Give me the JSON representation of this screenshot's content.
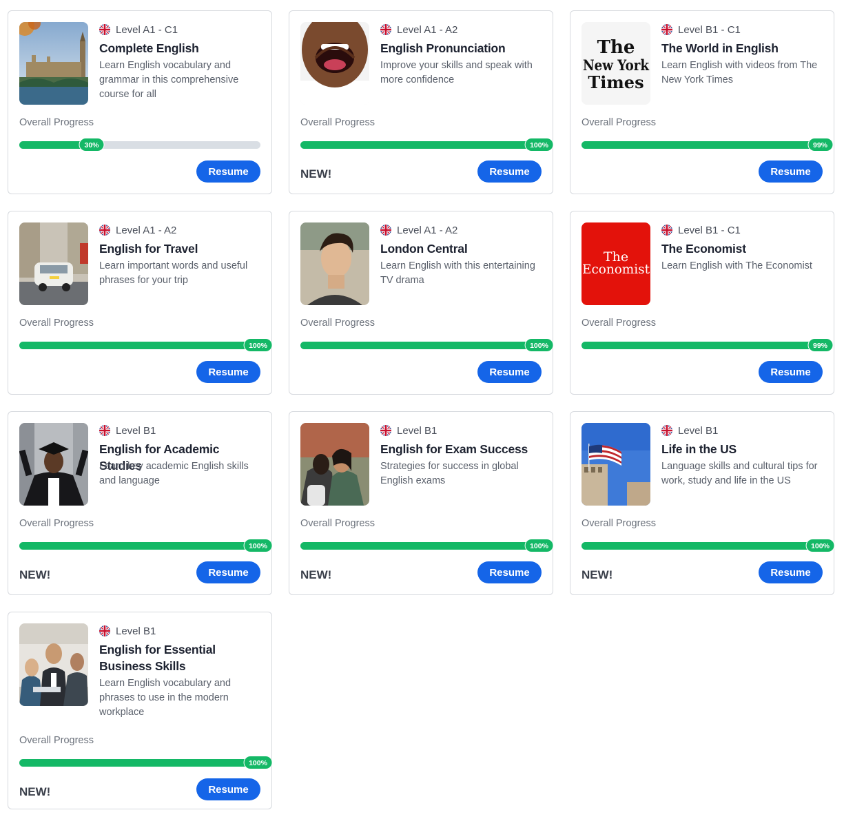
{
  "progress_label": "Overall Progress",
  "resume_label": "Resume",
  "new_label": "NEW!",
  "accent_color": "#14b866",
  "button_color": "#1565e8",
  "courses": [
    {
      "level": "Level A1 - C1",
      "title": "Complete English",
      "description": "Learn English vocabulary and grammar in this comprehensive course for all",
      "progress": 30,
      "progress_text": "30%",
      "is_new": false,
      "thumb": "london-bridge-image"
    },
    {
      "level": "Level A1 - A2",
      "title": "English Pronunciation",
      "description": "Improve your skills and speak with more confidence",
      "progress": 100,
      "progress_text": "100%",
      "is_new": true,
      "thumb": "open-mouth-image"
    },
    {
      "level": "Level B1 - C1",
      "title": "The World in English",
      "description": "Learn English with videos from The New York Times",
      "progress": 99,
      "progress_text": "99%",
      "is_new": false,
      "thumb": "nyt-logo",
      "logo_text": [
        "The",
        "New York",
        "Times"
      ]
    },
    {
      "level": "Level A1 - A2",
      "title": "English for Travel",
      "description": "Learn important words and useful phrases for your trip",
      "progress": 100,
      "progress_text": "100%",
      "is_new": false,
      "thumb": "london-taxi-image"
    },
    {
      "level": "Level A1 - A2",
      "title": "London Central",
      "description": "Learn English with this entertaining TV drama",
      "progress": 100,
      "progress_text": "100%",
      "is_new": false,
      "thumb": "young-man-image"
    },
    {
      "level": "Level B1 - C1",
      "title": "The Economist",
      "description": "Learn English with The Economist",
      "progress": 99,
      "progress_text": "99%",
      "is_new": false,
      "thumb": "economist-logo",
      "logo_text": [
        "The",
        "Economist"
      ]
    },
    {
      "level": "Level B1",
      "title": "English for Academic Studies",
      "description": "Learn key academic English skills and language",
      "progress": 100,
      "progress_text": "100%",
      "is_new": true,
      "thumb": "graduate-image"
    },
    {
      "level": "Level B1",
      "title": "English for Exam Success",
      "description": "Strategies for success in global English exams",
      "progress": 100,
      "progress_text": "100%",
      "is_new": true,
      "thumb": "students-hug-image"
    },
    {
      "level": "Level B1",
      "title": "Life in the US",
      "description": "Language skills and cultural tips for work, study and life in the US",
      "progress": 100,
      "progress_text": "100%",
      "is_new": true,
      "thumb": "us-flag-image"
    },
    {
      "level": "Level B1",
      "title": "English for Essential Business Skills",
      "description": "Learn English vocabulary and phrases to use in the modern workplace",
      "progress": 100,
      "progress_text": "100%",
      "is_new": true,
      "thumb": "business-meeting-image"
    }
  ]
}
